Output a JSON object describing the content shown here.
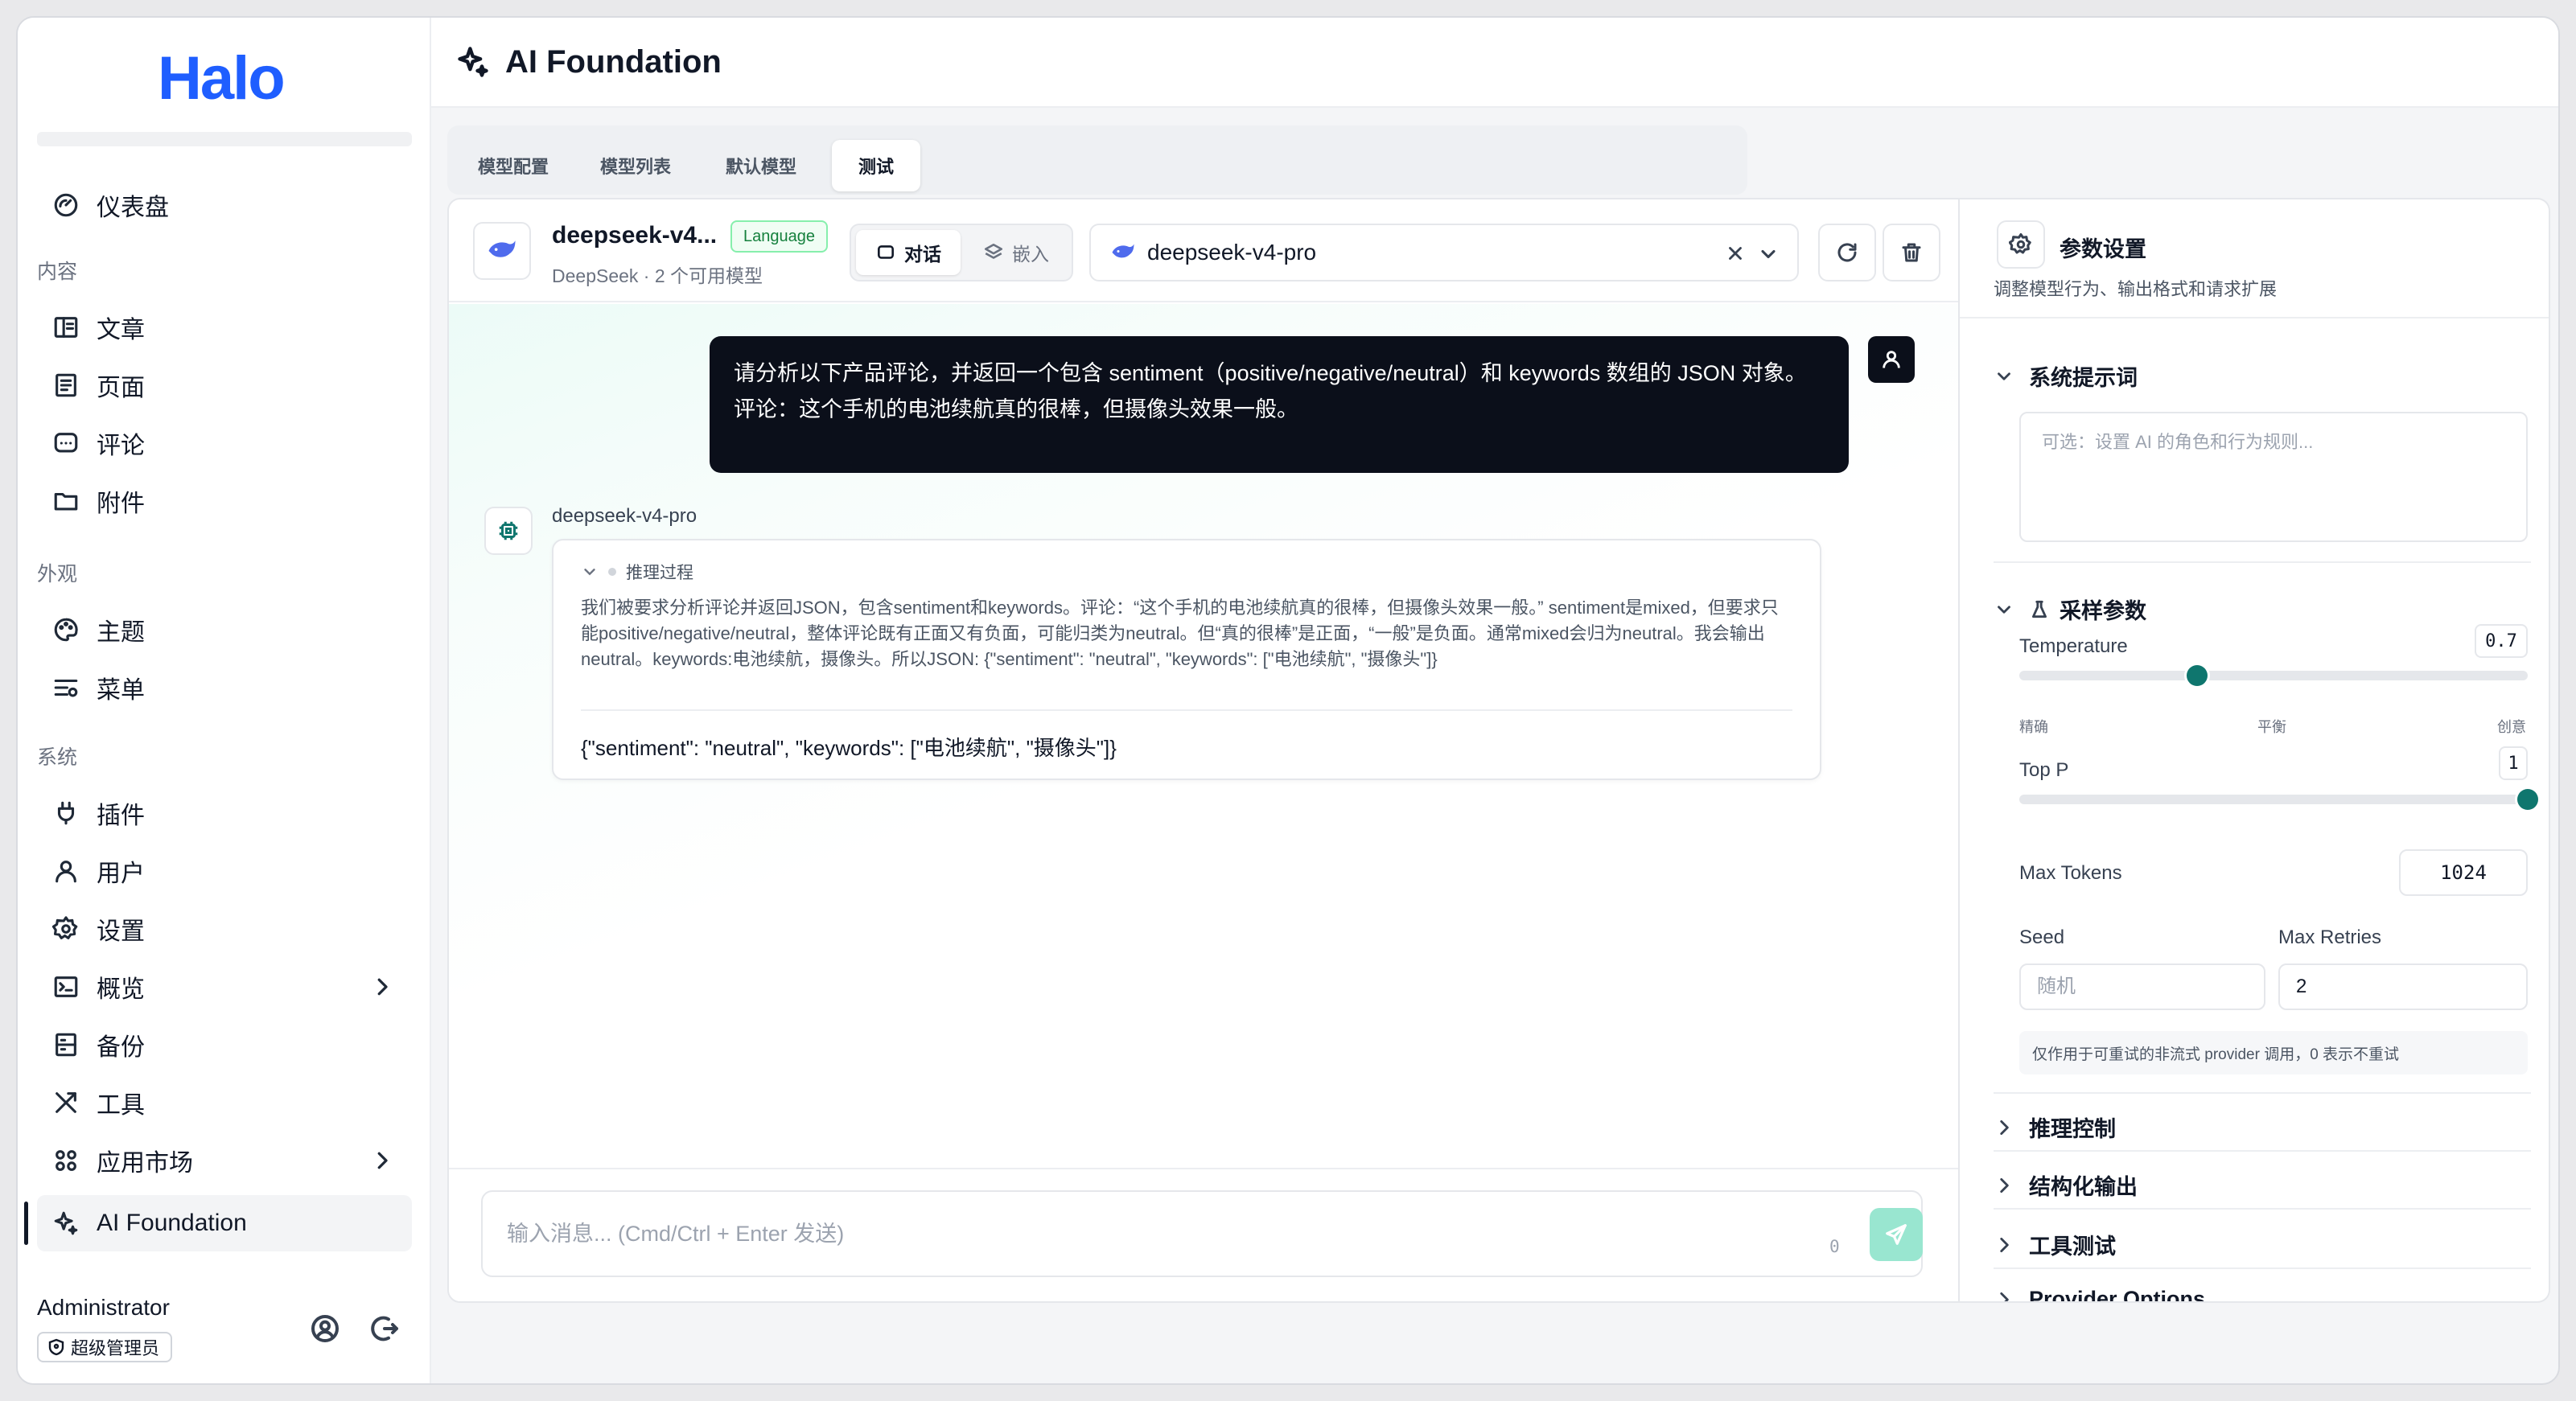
{
  "app": {
    "logo": "Halo",
    "page_title": "AI Foundation"
  },
  "sidebar": {
    "groups": {
      "content": "内容",
      "appearance": "外观",
      "system": "系统"
    },
    "items": [
      {
        "label": "仪表盘",
        "icon": "dashboard-icon"
      },
      {
        "label": "文章",
        "icon": "book-icon"
      },
      {
        "label": "页面",
        "icon": "page-icon"
      },
      {
        "label": "评论",
        "icon": "comment-icon"
      },
      {
        "label": "附件",
        "icon": "folder-icon"
      },
      {
        "label": "主题",
        "icon": "palette-icon"
      },
      {
        "label": "菜单",
        "icon": "menu-icon"
      },
      {
        "label": "插件",
        "icon": "plug-icon"
      },
      {
        "label": "用户",
        "icon": "user-icon"
      },
      {
        "label": "设置",
        "icon": "gear-icon"
      },
      {
        "label": "概览",
        "icon": "terminal-icon"
      },
      {
        "label": "备份",
        "icon": "backup-icon"
      },
      {
        "label": "工具",
        "icon": "tools-icon"
      },
      {
        "label": "应用市场",
        "icon": "apps-icon"
      },
      {
        "label": "AI Foundation",
        "icon": "sparkle-icon"
      }
    ],
    "user": {
      "name": "Administrator",
      "role": "超级管理员"
    }
  },
  "tabs": [
    "模型配置",
    "模型列表",
    "默认模型",
    "测试"
  ],
  "active_tab": "测试",
  "chat": {
    "model_name": "deepseek-v4...",
    "model_tag": "Language",
    "model_sub": "DeepSeek · 2 个可用模型",
    "modes": [
      "对话",
      "嵌入"
    ],
    "selected_model": "deepseek-v4-pro",
    "user_message_line1": "请分析以下产品评论，并返回一个包含 sentiment（positive/negative/neutral）和 keywords 数组的 JSON 对象。",
    "user_message_line2": "评论：这个手机的电池续航真的很棒，但摄像头效果一般。",
    "bot_name": "deepseek-v4-pro",
    "reasoning_label": "推理过程",
    "reasoning_text": "我们被要求分析评论并返回JSON，包含sentiment和keywords。评论：“这个手机的电池续航真的很棒，但摄像头效果一般。” sentiment是mixed，但要求只能positive/negative/neutral，整体评论既有正面又有负面，可能归类为neutral。但“真的很棒”是正面，“一般”是负面。通常mixed会归为neutral。我会输出neutral。keywords:电池续航，摄像头。所以JSON: {\"sentiment\": \"neutral\", \"keywords\": [\"电池续航\", \"摄像头\"]}",
    "answer": "{\"sentiment\": \"neutral\", \"keywords\": [\"电池续航\", \"摄像头\"]}",
    "input_placeholder": "输入消息... (Cmd/Ctrl + Enter 发送)",
    "char_count": "0"
  },
  "params": {
    "title": "参数设置",
    "subtitle": "调整模型行为、输出格式和请求扩展",
    "system_prompt_title": "系统提示词",
    "system_prompt_placeholder": "可选：设置 AI 的角色和行为规则...",
    "sampling_title": "采样参数",
    "temperature_label": "Temperature",
    "temperature_value": "0.7",
    "temperature_fraction": 0.35,
    "temperature_captions": [
      "精确",
      "平衡",
      "创意"
    ],
    "top_p_label": "Top P",
    "top_p_value": "1",
    "top_p_fraction": 1.0,
    "max_tokens_label": "Max Tokens",
    "max_tokens_value": "1024",
    "seed_label": "Seed",
    "seed_placeholder": "随机",
    "max_retries_label": "Max Retries",
    "max_retries_value": "2",
    "retry_hint": "仅作用于可重试的非流式 provider 调用，0 表示不重试",
    "collapsed_sections": [
      "推理控制",
      "结构化输出",
      "工具测试",
      "Provider Options"
    ]
  },
  "colors": {
    "brand": "#1f5eff",
    "accent": "#0f766e",
    "send_button": "#99e6d0",
    "user_bubble": "#0b0f1a"
  }
}
